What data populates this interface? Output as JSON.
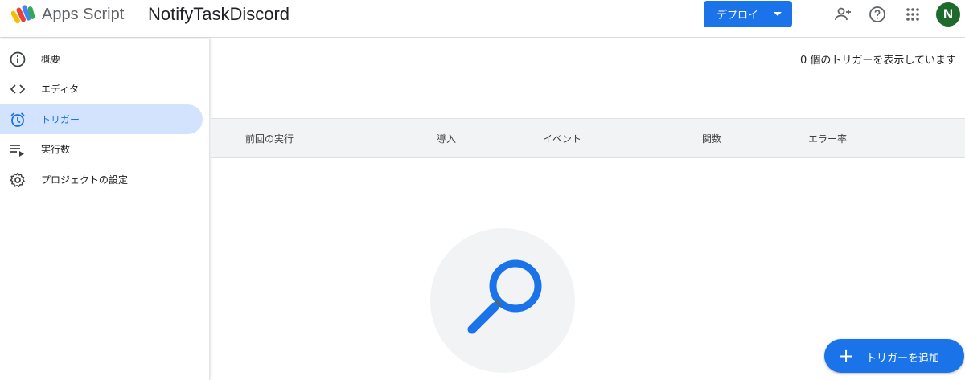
{
  "header": {
    "app_name": "Apps Script",
    "project_title": "NotifyTaskDiscord",
    "deploy_label": "デプロイ",
    "avatar_initial": "N",
    "icons": [
      "person-add-icon",
      "help-icon",
      "apps-grid-icon"
    ]
  },
  "sidebar": {
    "items": [
      {
        "label": "概要",
        "icon": "info-icon",
        "active": false
      },
      {
        "label": "エディタ",
        "icon": "code-icon",
        "active": false
      },
      {
        "label": "トリガー",
        "icon": "alarm-icon",
        "active": true
      },
      {
        "label": "実行数",
        "icon": "playlist-play-icon",
        "active": false
      },
      {
        "label": "プロジェクトの設定",
        "icon": "gear-icon",
        "active": false
      }
    ]
  },
  "main": {
    "trigger_count_text": "0 個のトリガーを表示しています",
    "columns": [
      "前回の実行",
      "導入",
      "イベント",
      "関数",
      "エラー率"
    ],
    "empty_state_icon": "search-icon",
    "add_trigger_label": "トリガーを追加"
  },
  "colors": {
    "accent": "#1a73e8",
    "active_nav_bg": "#d3e3fd",
    "avatar_bg": "#1e6a2d"
  }
}
